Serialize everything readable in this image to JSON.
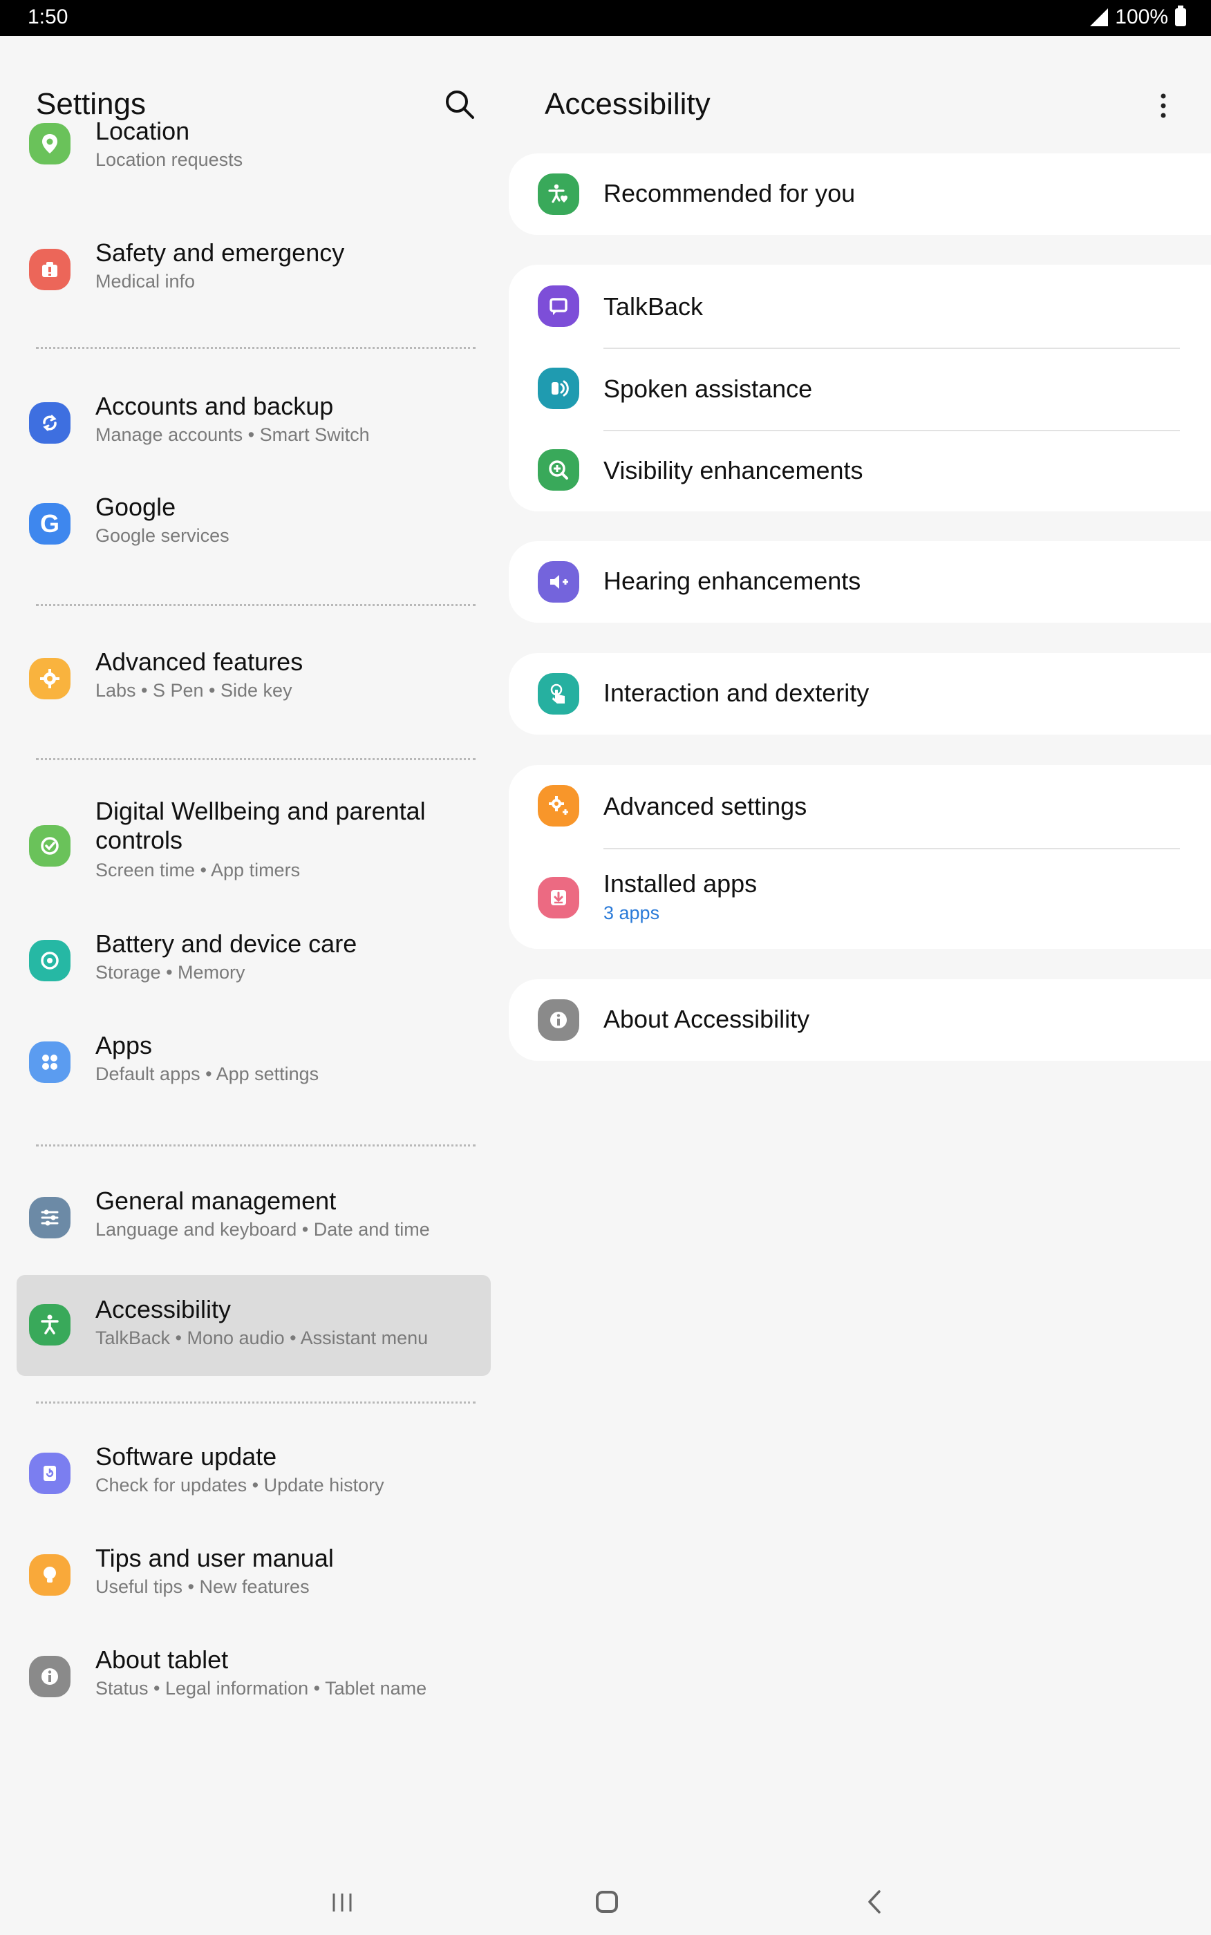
{
  "status": {
    "time": "1:50",
    "battery": "100%"
  },
  "left": {
    "header": "Settings",
    "items": [
      {
        "title": "Location",
        "sub": "Location requests",
        "icon": "location-pin-icon",
        "color": "#6ac25a"
      },
      {
        "title": "Safety and emergency",
        "sub": "Medical info",
        "icon": "alert-icon",
        "color": "#ec6659"
      },
      {
        "title": "Accounts and backup",
        "sub": "Manage accounts  •  Smart Switch",
        "icon": "sync-icon",
        "color": "#3e6fe0"
      },
      {
        "title": "Google",
        "sub": "Google services",
        "icon": "google-icon",
        "color": "#3e87ee"
      },
      {
        "title": "Advanced features",
        "sub": "Labs  •  S Pen  •  Side key",
        "icon": "gear-plus-icon",
        "color": "#f9b33e"
      },
      {
        "title": "Digital Wellbeing and parental",
        "title2": "controls",
        "sub": "Screen time  •  App timers",
        "icon": "wellbeing-icon",
        "color": "#6ac25a"
      },
      {
        "title": "Battery and device care",
        "sub": "Storage  •  Memory",
        "icon": "device-care-icon",
        "color": "#26b8a4"
      },
      {
        "title": "Apps",
        "sub": "Default apps  •  App settings",
        "icon": "apps-grid-icon",
        "color": "#5b9cf0"
      },
      {
        "title": "General management",
        "sub": "Language and keyboard  •  Date and time",
        "icon": "sliders-icon",
        "color": "#6c8aa6"
      },
      {
        "title": "Accessibility",
        "sub": "TalkBack  •  Mono audio  •  Assistant menu",
        "icon": "accessibility-icon",
        "color": "#39a95a"
      },
      {
        "title": "Software update",
        "sub": "Check for updates  •  Update history",
        "icon": "software-update-icon",
        "color": "#7b7ef0"
      },
      {
        "title": "Tips and user manual",
        "sub": "Useful tips  •  New features",
        "icon": "lightbulb-icon",
        "color": "#f9a93a"
      },
      {
        "title": "About tablet",
        "sub": "Status  •  Legal information  •  Tablet name",
        "icon": "info-icon",
        "color": "#8a8a8a"
      }
    ]
  },
  "right": {
    "header": "Accessibility",
    "recommended": {
      "title": "Recommended for you",
      "icon": "accessibility-heart-icon",
      "color": "#39a95a"
    },
    "talkback": {
      "title": "TalkBack",
      "icon": "talkback-icon",
      "color": "#7d4ed8"
    },
    "spoken": {
      "title": "Spoken assistance",
      "icon": "spoken-assistance-icon",
      "color": "#1f9bb0"
    },
    "visibility": {
      "title": "Visibility enhancements",
      "icon": "magnify-plus-icon",
      "color": "#39a95a"
    },
    "hearing": {
      "title": "Hearing enhancements",
      "icon": "hearing-icon",
      "color": "#7464dc"
    },
    "interaction": {
      "title": "Interaction and dexterity",
      "icon": "touch-icon",
      "color": "#26b0a0"
    },
    "advanced": {
      "title": "Advanced settings",
      "icon": "gear-plus-icon",
      "color": "#f8962a"
    },
    "installed": {
      "title": "Installed apps",
      "sub": "3 apps",
      "icon": "download-icon",
      "color": "#ec6a82"
    },
    "about": {
      "title": "About Accessibility",
      "icon": "info-icon",
      "color": "#8a8a8a"
    }
  }
}
